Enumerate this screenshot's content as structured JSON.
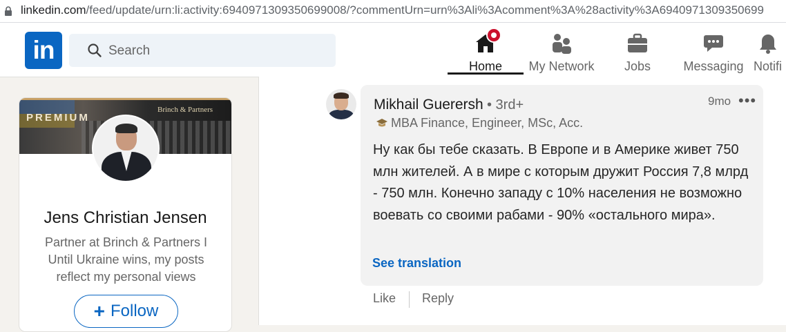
{
  "browser": {
    "url_host": "linkedin.com",
    "url_rest": "/feed/update/urn:li:activity:6940971309350699008/?commentUrn=urn%3Ali%3Acomment%3A%28activity%3A6940971309350699"
  },
  "nav": {
    "logo_text": "in",
    "search_placeholder": "Search",
    "items": [
      {
        "label": "Home",
        "icon": "home-icon",
        "active": true
      },
      {
        "label": "My Network",
        "icon": "network-icon"
      },
      {
        "label": "Jobs",
        "icon": "briefcase-icon"
      },
      {
        "label": "Messaging",
        "icon": "messaging-icon"
      },
      {
        "label": "Notifi",
        "icon": "bell-icon"
      }
    ]
  },
  "profile": {
    "banner_tag": "PREMIUM",
    "banner_brand": "Brinch & Partners",
    "name": "Jens Christian Jensen",
    "headline": "Partner at Brinch & Partners I Until Ukraine wins, my posts reflect my personal views",
    "follow_label": "Follow"
  },
  "comment": {
    "author": "Mikhail Guerersh",
    "degree": "• 3rd+",
    "time": "9mo",
    "more": "•••",
    "headline": "MBA Finance, Engineer, MSc, Acc.",
    "text": "Ну как бы тебе сказать. В Европе и в Америке живет 750 млн жителей. А в мире с которым дружит Россия 7,8 млрд - 750 млн. Конечно западу с 10% населения не возможно воевать со своими рабами - 90% «остального мира».",
    "see_translation": "See translation",
    "like": "Like",
    "reply": "Reply"
  },
  "colors": {
    "brand": "#0a66c2",
    "badge": "#cb112d",
    "page_bg": "#f4f2ee"
  }
}
